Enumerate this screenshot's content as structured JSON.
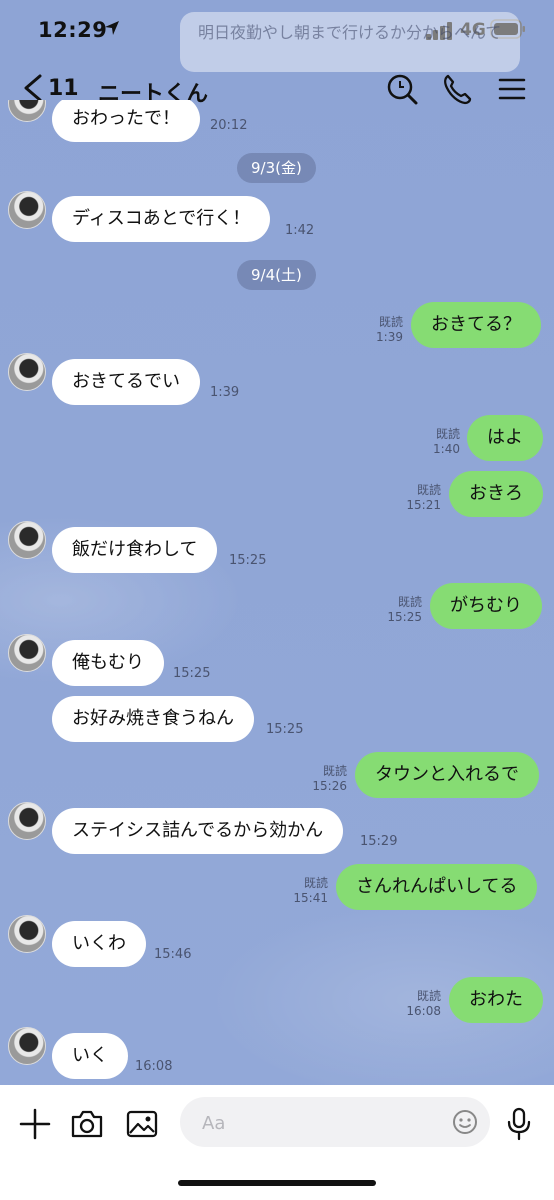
{
  "status": {
    "time": "12:29",
    "network": "4G"
  },
  "notification": {
    "text": "明日夜勤やし朝まで行けるか分からへんて"
  },
  "header": {
    "back_count": "11",
    "title": "ニートくん"
  },
  "messages": {
    "m0": {
      "text": "おわったで！",
      "time": "20:12"
    },
    "d1": "9/3(金)",
    "m1": {
      "text": "ディスコあとで行く！",
      "time": "1:42"
    },
    "d2": "9/4(土)",
    "m2": {
      "text": "おきてる？",
      "read": "既読",
      "time": "1:39"
    },
    "m3": {
      "text": "おきてるでい",
      "time": "1:39"
    },
    "m4": {
      "text": "はよ",
      "read": "既読",
      "time": "1:40"
    },
    "m5": {
      "text": "おきろ",
      "read": "既読",
      "time": "15:21"
    },
    "m6": {
      "text": "飯だけ食わして",
      "time": "15:25"
    },
    "m7": {
      "text": "がちむり",
      "read": "既読",
      "time": "15:25"
    },
    "m8": {
      "text": "俺もむり",
      "time": "15:25"
    },
    "m9": {
      "text": "お好み焼き食うねん",
      "time": "15:25"
    },
    "m10": {
      "text": "タウンと入れるで",
      "read": "既読",
      "time": "15:26"
    },
    "m11": {
      "text": "ステイシス詰んでるから効かん",
      "time": "15:29"
    },
    "m12": {
      "text": "さんれんぱいしてる",
      "read": "既読",
      "time": "15:41"
    },
    "m13": {
      "text": "いくわ",
      "time": "15:46"
    },
    "m14": {
      "text": "おわた",
      "read": "既読",
      "time": "16:08"
    },
    "m15": {
      "text": "いく",
      "time": "16:08"
    }
  },
  "input": {
    "placeholder": "Aa"
  },
  "icons": {
    "back": "chevron-left-icon",
    "search": "search-icon",
    "call": "phone-icon",
    "menu": "menu-icon",
    "add": "plus-icon",
    "camera": "camera-icon",
    "image": "image-icon",
    "emoji": "emoji-icon",
    "mic": "microphone-icon"
  },
  "colors": {
    "background": "#8fa6d6",
    "outgoing_bubble": "#86dc73",
    "incoming_bubble": "#ffffff"
  }
}
